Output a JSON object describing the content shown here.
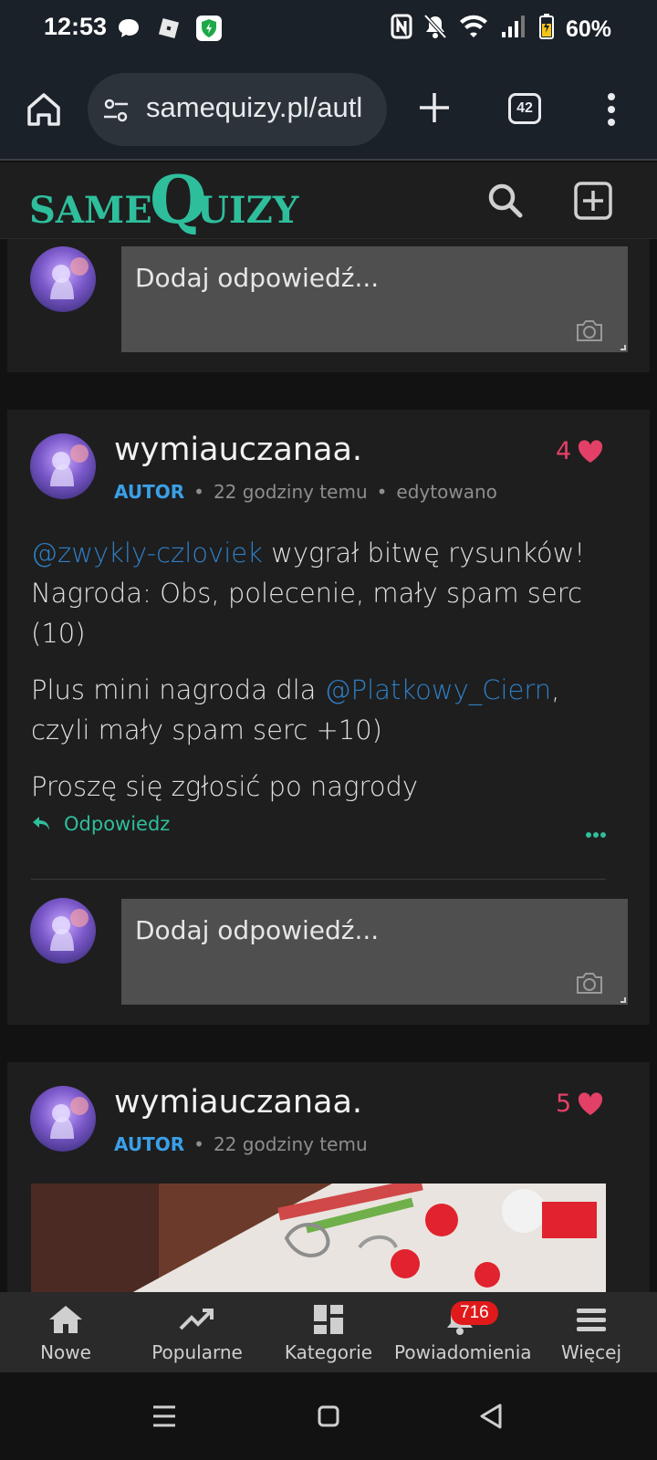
{
  "status_bar": {
    "time": "12:53",
    "battery": "60%"
  },
  "browser": {
    "url": "samequizy.pl/autl",
    "tab_count": "42"
  },
  "site": {
    "logo_same": "SAME",
    "logo_quizy": "QUIZY"
  },
  "top_reply": {
    "placeholder": "Dodaj odpowiedź..."
  },
  "comment1": {
    "author": "wymiauczanaa.",
    "role": "AUTOR",
    "time": "22 godziny temu",
    "edited": "edytowano",
    "likes": "4",
    "p1_mention": "@zwykly-czloviek",
    "p1_rest": " wygrał bitwę rysunków! Nagroda: Obs, polecenie, mały spam serc (10)",
    "p2_start": "Plus mini nagroda dla ",
    "p2_mention": "@Platkowy_Ciern",
    "p2_rest": ", czyli mały spam serc +10)",
    "p3": "Proszę się zgłosić po nagrody",
    "reply_label": "Odpowiedz",
    "reply_placeholder": "Dodaj odpowiedź..."
  },
  "comment2": {
    "author": "wymiauczanaa.",
    "role": "AUTOR",
    "time": "22 godziny temu",
    "likes": "5"
  },
  "bottom_nav": {
    "items": [
      {
        "label": "Nowe"
      },
      {
        "label": "Popularne"
      },
      {
        "label": "Kategorie"
      },
      {
        "label": "Powiadomienia",
        "badge": "716"
      },
      {
        "label": "Więcej"
      }
    ]
  },
  "colors": {
    "accent_teal": "#2fbe9c",
    "mention_blue": "#2f7fc6",
    "like_red": "#e34067",
    "badge_red": "#e01a1a"
  }
}
